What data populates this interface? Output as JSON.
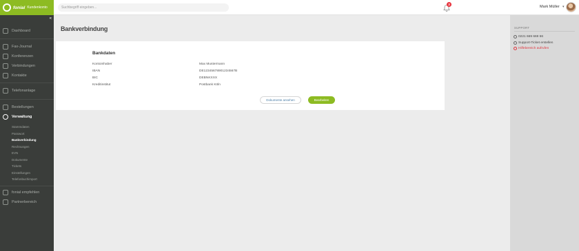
{
  "header": {
    "brand": "fonial",
    "subtitle": "Kundenkonto",
    "search_placeholder": "Suchbegriff eingeben...",
    "notification_count": "3",
    "user_name": "Mark Müller",
    "accent_color": "#8dbb22"
  },
  "sidebar": {
    "collapse": "«",
    "items": [
      {
        "label": "Dashboard",
        "icon": "dashboard-icon"
      },
      {
        "label": "Fax-Journal",
        "icon": "fax-icon"
      },
      {
        "label": "Konferenzen",
        "icon": "conference-icon"
      },
      {
        "label": "Verbindungen",
        "icon": "connections-icon"
      },
      {
        "label": "Kontakte",
        "icon": "contacts-icon"
      },
      {
        "label": "Telefonanlage",
        "icon": "phone-system-icon"
      },
      {
        "label": "Bestellungen",
        "icon": "orders-icon"
      },
      {
        "label": "Verwaltung",
        "icon": "gear-icon"
      },
      {
        "label": "fonial empfehlen",
        "icon": "recommend-icon"
      },
      {
        "label": "Partnerbereich",
        "icon": "partner-icon"
      }
    ],
    "subitems": [
      "Stammdaten",
      "Passwort",
      "Bankverbindung",
      "Rechnungen",
      "EVN",
      "Dokumente",
      "Tickets",
      "Einstellungen",
      "Telefonbuchimport"
    ]
  },
  "main": {
    "title": "Bankverbindung",
    "card_title": "Bankdaten",
    "rows": [
      {
        "label": "Kontoinhaber",
        "value": "Max Mustermann"
      },
      {
        "label": "IBAN",
        "value": "DE12345678901234567B"
      },
      {
        "label": "BIC",
        "value": "DEBNKXXX"
      },
      {
        "label": "Kreditinstitut",
        "value": "Postbank Köln"
      }
    ],
    "docs_button": "Dokumente ansehen",
    "edit_button": "Bearbeiten"
  },
  "support": {
    "title": "SUPPORT",
    "phone": "0221 669 669 66",
    "ticket": "Support-Ticket erstellen",
    "help": "Hilfebereich aufrufen"
  }
}
